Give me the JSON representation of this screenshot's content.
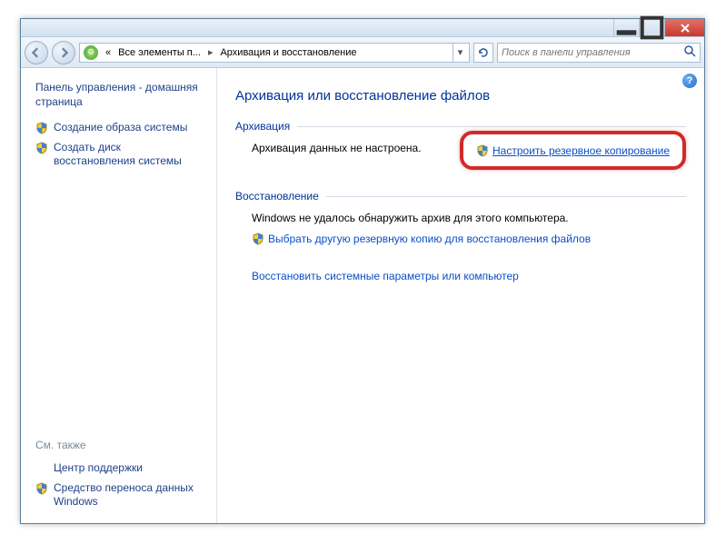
{
  "breadcrumb": {
    "prefix": "«",
    "segment1": "Все элементы п...",
    "segment2": "Архивация и восстановление"
  },
  "search": {
    "placeholder": "Поиск в панели управления"
  },
  "sidebar": {
    "title": "Панель управления - домашняя страница",
    "links": [
      "Создание образа системы",
      "Создать диск восстановления системы"
    ],
    "see_also_label": "См. также",
    "see_also_links": [
      "Центр поддержки",
      "Средство переноса данных Windows"
    ]
  },
  "main": {
    "title": "Архивация или восстановление файлов",
    "backup": {
      "header": "Архивация",
      "status": "Архивация данных не настроена.",
      "action": "Настроить резервное копирование"
    },
    "restore": {
      "header": "Восстановление",
      "status": "Windows не удалось обнаружить архив для этого компьютера.",
      "link1": "Выбрать другую резервную копию для восстановления файлов",
      "link2": "Восстановить системные параметры или компьютер"
    }
  }
}
